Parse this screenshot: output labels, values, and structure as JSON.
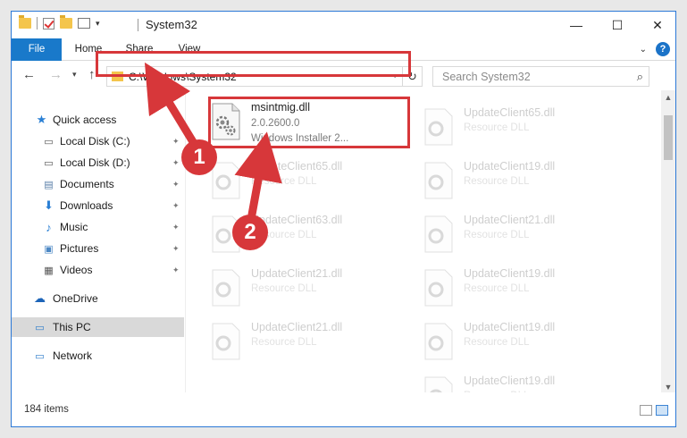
{
  "window": {
    "title": "System32",
    "controls": {
      "minimize": "—",
      "maximize": "☐",
      "close": "✕"
    }
  },
  "ribbon": {
    "tabs": [
      "File",
      "Home",
      "Share",
      "View"
    ],
    "help": "?"
  },
  "address_bar": {
    "path": "C:\\Windows\\System32",
    "search_placeholder": "Search System32"
  },
  "nav": {
    "items": [
      {
        "label": "Quick access",
        "icon": "star-icon"
      },
      {
        "label": "Local Disk (C:)",
        "icon": "drive-icon"
      },
      {
        "label": "Local Disk (D:)",
        "icon": "drive-icon"
      },
      {
        "label": "Documents",
        "icon": "documents-icon"
      },
      {
        "label": "Downloads",
        "icon": "download-icon"
      },
      {
        "label": "Music",
        "icon": "music-icon"
      },
      {
        "label": "Pictures",
        "icon": "pictures-icon"
      },
      {
        "label": "Videos",
        "icon": "videos-icon"
      },
      {
        "label": "OneDrive",
        "icon": "cloud-icon"
      },
      {
        "label": "This PC",
        "icon": "computer-icon"
      },
      {
        "label": "Network",
        "icon": "network-icon"
      }
    ]
  },
  "files": {
    "highlighted": {
      "name": "msintmig.dll",
      "version": "2.0.2600.0",
      "description": "Windows Installer 2..."
    },
    "faded": [
      {
        "name": "UpdateClient65.dll",
        "type": "Resource DLL"
      },
      {
        "name": "UpdateClient65.dll",
        "type": "Resource DLL"
      },
      {
        "name": "UpdateClient19.dll",
        "type": "Resource DLL"
      },
      {
        "name": "UpdateClient63.dll",
        "type": "Resource DLL"
      },
      {
        "name": "UpdateClient21.dll",
        "type": "Resource DLL"
      },
      {
        "name": "UpdateClient21.dll",
        "type": "Resource DLL"
      },
      {
        "name": "UpdateClient19.dll",
        "type": "Resource DLL"
      },
      {
        "name": "UpdateClient21.dll",
        "type": "Resource DLL"
      },
      {
        "name": "UpdateClient19.dll",
        "type": "Resource DLL"
      },
      {
        "name": "UpdateClient19.dll",
        "type": "Resource DLL"
      }
    ]
  },
  "status_bar": {
    "item_count": "184 items"
  },
  "annotations": {
    "marker_1": "1",
    "marker_2": "2",
    "color": "#d7373a"
  }
}
